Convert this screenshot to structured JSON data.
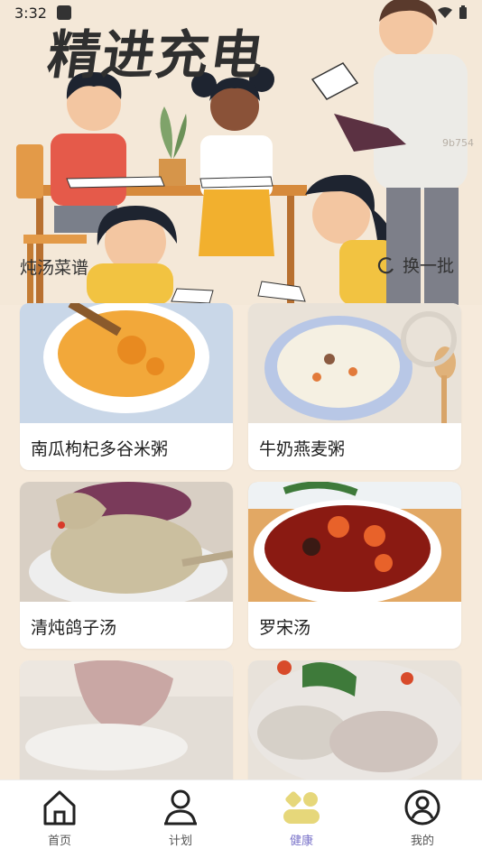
{
  "status_bar": {
    "time": "3:32"
  },
  "banner": {
    "title": "精进充电",
    "watermark": "9b754"
  },
  "section": {
    "title": "炖汤菜谱",
    "refresh_label": "换一批"
  },
  "recipes": [
    {
      "name": "南瓜枸杞多谷米粥"
    },
    {
      "name": "牛奶燕麦粥"
    },
    {
      "name": "清炖鸽子汤"
    },
    {
      "name": "罗宋汤"
    },
    {
      "name": ""
    },
    {
      "name": ""
    }
  ],
  "bottom_nav": [
    {
      "label": "首页",
      "icon": "home-icon"
    },
    {
      "label": "计划",
      "icon": "person-icon"
    },
    {
      "label": "健康",
      "icon": "health-icon"
    },
    {
      "label": "我的",
      "icon": "profile-icon"
    }
  ],
  "colors": {
    "active_tab": "#7a73c9",
    "active_icon": "#e6d77a",
    "background": "#f6eadb"
  }
}
